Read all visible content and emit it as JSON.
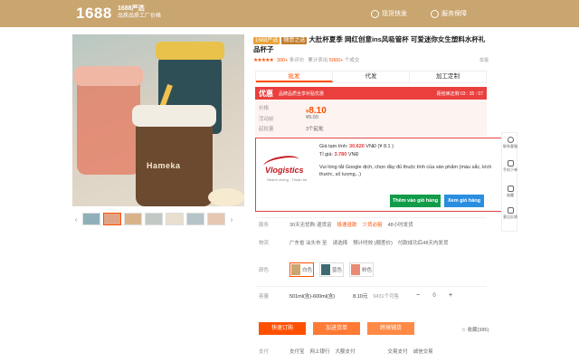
{
  "header": {
    "logo": "1688",
    "sub_title": "1688严选",
    "sub_tagline": "品质品质工厂价格",
    "right_links": [
      "现货快发",
      "服务保障"
    ]
  },
  "product": {
    "badges": [
      "1688严选",
      "随意之选"
    ],
    "title": "大肚杯夏季 网红创意ins风吸管杯 可爱迷你女生塑料水杯礼品杯子",
    "cup_brand": "Hameka",
    "rating_stars": "★★★★★",
    "reviews_count": "300+",
    "reviews_label": "条评价",
    "sold_label": "累计卖出",
    "sold_count": "5000+",
    "sold_unit": "个成交",
    "report": "举报"
  },
  "tabs": [
    {
      "label": "批发",
      "active": true
    },
    {
      "label": "代发",
      "active": false
    },
    {
      "label": "加工定制",
      "active": false
    }
  ],
  "promo": {
    "label": "优惠",
    "text": "品牌品质全享补贴优惠",
    "countdown": "距结束还剩 03 : 35 : 07"
  },
  "price": {
    "label": "价格",
    "currency": "¥",
    "value": "8.10",
    "activity_label": "活动前",
    "activity_value": "¥9.00",
    "moq_label": "起批量",
    "moq_value": "3个起批"
  },
  "overlay": {
    "logo_text": "Vlogistics",
    "logo_sub": "Nhanh chóng - Thuận lợi",
    "price_label": "Giá tạm tính:",
    "price_vnd": "30.620",
    "price_vnd_unit": "VNĐ",
    "price_cny": "(¥ 8.1 )",
    "rate_label": "Tỉ giá:",
    "rate_value": "3.780",
    "rate_unit": "VNĐ",
    "message": "Vui lòng tắt Google dịch, chọn đầy đủ thuộc tính của sản phẩm (màu sắc, kích thước, số lượng...)",
    "add_cart": "Thêm vào giỏ hàng",
    "view_cart": "Xem giỏ hàng"
  },
  "sidebar": [
    {
      "label": "联系客服"
    },
    {
      "label": "手机下单"
    },
    {
      "label": "收藏"
    },
    {
      "label": "意见反馈"
    }
  ],
  "service": {
    "label": "服务",
    "items": [
      "30天无忧购·退货运",
      "极速退款",
      "少货必赔",
      "48小时发货"
    ]
  },
  "logistics": {
    "label": "物流",
    "from": "广东省 汕头市 至",
    "dest": "请选择",
    "option": "预计时效 (顺差价)",
    "note": "付款成功后48天内发货"
  },
  "color": {
    "label": "颜色",
    "options": [
      {
        "name": "白色",
        "selected": true,
        "color": "#c9a56f"
      },
      {
        "name": "蓝色",
        "selected": false,
        "color": "#3f6a73"
      },
      {
        "name": "粉色",
        "selected": false,
        "color": "#e98a74"
      }
    ]
  },
  "capacity": {
    "label": "容量",
    "value": "501ml(含)-600ml(含)",
    "unit_price": "8.10元",
    "stock": "9431个可售",
    "qty": "0",
    "minus": "−",
    "plus": "+"
  },
  "actions": {
    "buy": "快速订购",
    "cart": "加进货单",
    "compare": "跨境铺货",
    "favorite": "收藏(386)"
  },
  "payment": {
    "label": "支付",
    "methods": [
      "支付宝",
      "网上银行",
      "大额支付"
    ],
    "more": "交易支付",
    "guarantee": "诚信交易"
  }
}
